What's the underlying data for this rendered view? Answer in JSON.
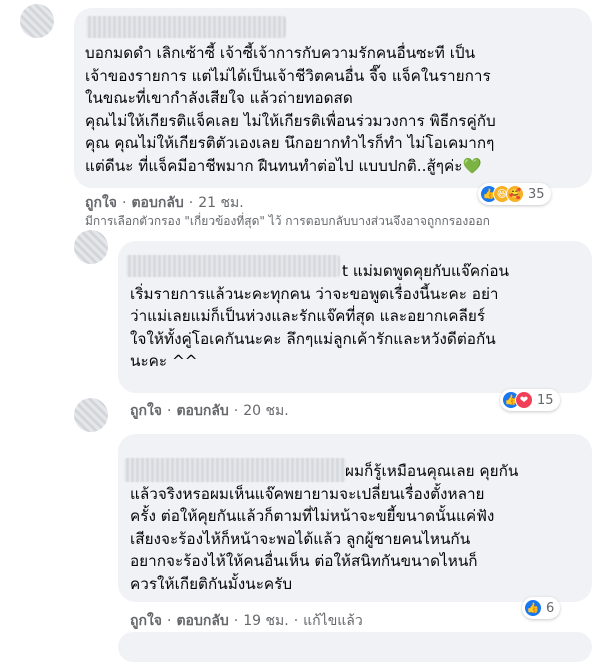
{
  "comments": [
    {
      "text": "บอกมดดำ เลิกเซ้าซี้ เจ้าซี้เจ้าการกับความรักคนอื่นซะที เป็น\nเจ้าของรายการ แต่ไม่ได้เป็นเจ้าชีวิตคนอื่น จี๊จ แจ็คในรายการ\nในขณะที่เขากำลังเสียใจ แล้วถ่ายทอดสด\nคุณไม่ให้เกียรติแจ็คเลย ไม่ให้เกียรติเพื่อนร่วมวงการ พิธีกรคู่กับ\nคุณ คุณไม่ให้เกียรติตัวเองเลย นึกอยากทำไรก็ทำ ไม่โอเคมากๆ\nแต่ดีนะ ที่แจ็คมีอาชีพมาก ฝืนทนทำต่อไป แบบปกติ..สู้ๆค่ะ💚",
      "like_label": "ถูกใจ",
      "reply_label": "ตอบกลับ",
      "time": "21 ชม.",
      "reaction_count": "35",
      "reactions": [
        "like",
        "haha",
        "care"
      ]
    },
    {
      "text": "t แม่มดพูดคุยกับแจ๊คก่อน\nเริ่มรายการแล้วนะคะทุกคน ว่าจะขอพูดเรื่องนี้นะคะ อย่า\nว่าแม่เลยแม่ก็เป็นห่วงและรักแจ๊คที่สุด และอยากเคลียร์\nใจให้ทั้งคู่โอเคกันนะคะ ลึกๆแม่ลูกเค้ารักและหวังดีต่อกัน\nนะคะ ^^",
      "like_label": "ถูกใจ",
      "reply_label": "ตอบกลับ",
      "time": "20 ชม.",
      "reaction_count": "15",
      "reactions": [
        "like",
        "love"
      ]
    },
    {
      "text": "ผมก็รู้เหมือนคุณเลย คุยกัน\nแล้วจริงหรอผมเห็นแจ๊คพยายามจะเปลี่ยนเรื่องตั้งหลาย\nครั้ง ต่อให้คุยกันแล้วก็ตามที่ไม่หน้าจะขยี้ขนาดนั้นแค่ฟัง\nเสียงจะร้องไห้ก็หน้าจะพอได้แล้ว ลูกผู้ชายคนไหนกัน\nอยากจะร้องไห้ให้คนอื่นเห็น ต่อให้สนิทกันขนาดไหนก็\nควรให้เกียติกันมั้งนะครับ",
      "like_label": "ถูกใจ",
      "reply_label": "ตอบกลับ",
      "time": "19 ชม.",
      "edited_label": "แก้ไขแล้ว",
      "reaction_count": "6",
      "reactions": [
        "like"
      ]
    }
  ],
  "filter_note": "มีการเลือกตัวกรอง \"เกี่ยวข้องที่สุด\" ไว้ การตอบกลับบางส่วนจึงอาจถูกกรองออก",
  "colors": {
    "bubble": "#f0f2f5",
    "meta_text": "#65676b",
    "like_blue": "#1877f2"
  }
}
